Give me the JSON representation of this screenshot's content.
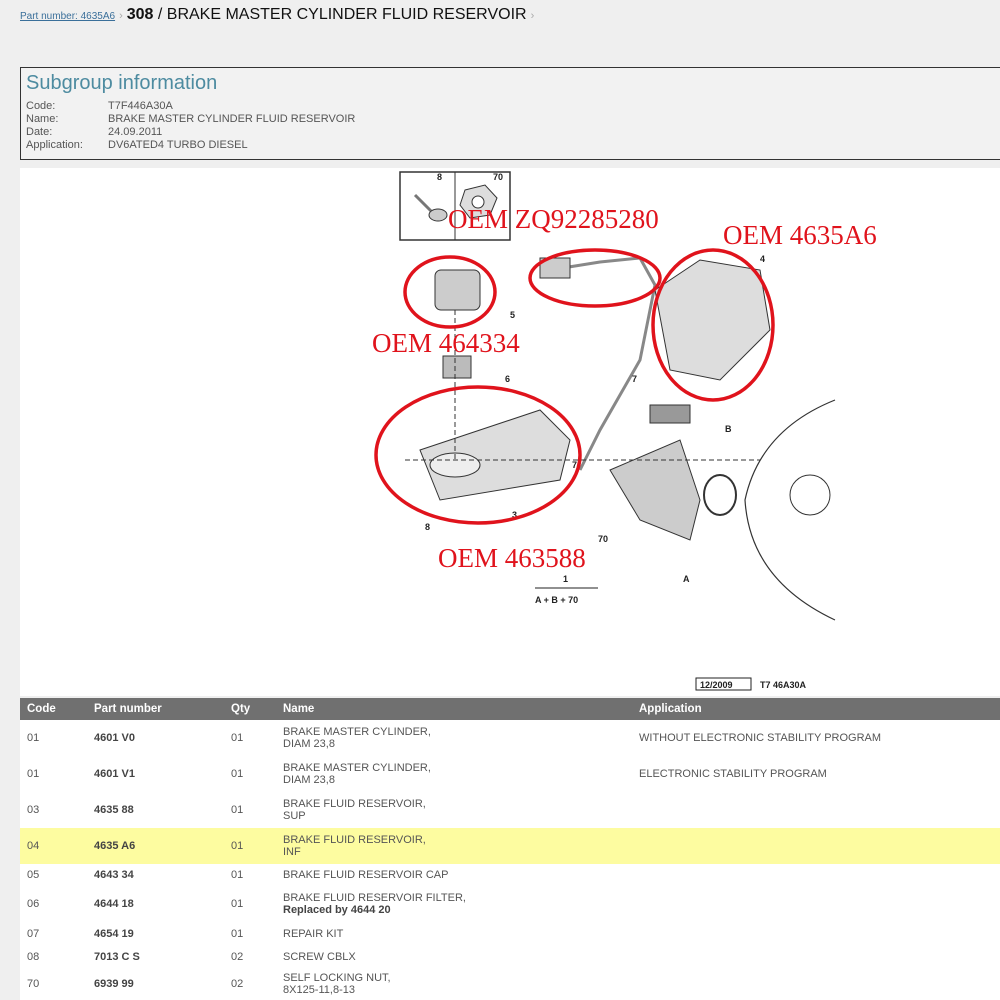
{
  "breadcrumb": {
    "link": "Part number: 4635A6",
    "title_code": "308",
    "title_name": "/ BRAKE MASTER CYLINDER FLUID RESERVOIR",
    "sep": "›"
  },
  "subgroup": {
    "heading": "Subgroup information",
    "fields": [
      {
        "label": "Code:",
        "value": "T7F446A30A"
      },
      {
        "label": "Name:",
        "value": "BRAKE MASTER CYLINDER FLUID RESERVOIR"
      },
      {
        "label": "Date:",
        "value": "24.09.2011"
      },
      {
        "label": "Application:",
        "value": "DV6ATED4 TURBO DIESEL"
      }
    ]
  },
  "diagram": {
    "oem_labels": [
      "OEM ZQ92285280",
      "OEM 4635A6",
      "OEM 464334",
      "OEM 463588"
    ],
    "callouts": [
      "8",
      "70",
      "5",
      "6",
      "4",
      "7",
      "7",
      "B",
      "3",
      "8",
      "70",
      "A",
      "1",
      "A + B + 70"
    ],
    "stamp_date": "12/2009",
    "stamp_code": "T7 46A30A"
  },
  "table": {
    "headers": [
      "Code",
      "Part number",
      "Qty",
      "Name",
      "Application"
    ],
    "rows": [
      {
        "code": "01",
        "part": "4601 V0",
        "qty": "01",
        "name": "BRAKE MASTER CYLINDER,",
        "name2": "DIAM 23,8",
        "app": "WITHOUT ELECTRONIC STABILITY PROGRAM"
      },
      {
        "code": "01",
        "part": "4601 V1",
        "qty": "01",
        "name": "BRAKE MASTER CYLINDER,",
        "name2": "DIAM 23,8",
        "app": "ELECTRONIC STABILITY PROGRAM"
      },
      {
        "code": "03",
        "part": "4635 88",
        "qty": "01",
        "name": "BRAKE FLUID RESERVOIR,",
        "name2": "SUP",
        "app": ""
      },
      {
        "code": "04",
        "part": "4635 A6",
        "qty": "01",
        "name": "BRAKE FLUID RESERVOIR,",
        "name2": "INF",
        "app": "",
        "highlight": true
      },
      {
        "code": "05",
        "part": "4643 34",
        "qty": "01",
        "name": "BRAKE FLUID RESERVOIR CAP",
        "name2": "",
        "app": ""
      },
      {
        "code": "06",
        "part": "4644 18",
        "qty": "01",
        "name": "BRAKE FLUID RESERVOIR FILTER,",
        "name2": "Replaced by 4644 20",
        "app": ""
      },
      {
        "code": "07",
        "part": "4654 19",
        "qty": "01",
        "name": "REPAIR KIT",
        "name2": "",
        "app": ""
      },
      {
        "code": "08",
        "part": "7013 C S",
        "qty": "02",
        "name": "SCREW CBLX",
        "name2": "",
        "app": ""
      },
      {
        "code": "70",
        "part": "6939 99",
        "qty": "02",
        "name": "SELF LOCKING NUT,",
        "name2": "8X125-11,8-13",
        "app": ""
      }
    ]
  }
}
